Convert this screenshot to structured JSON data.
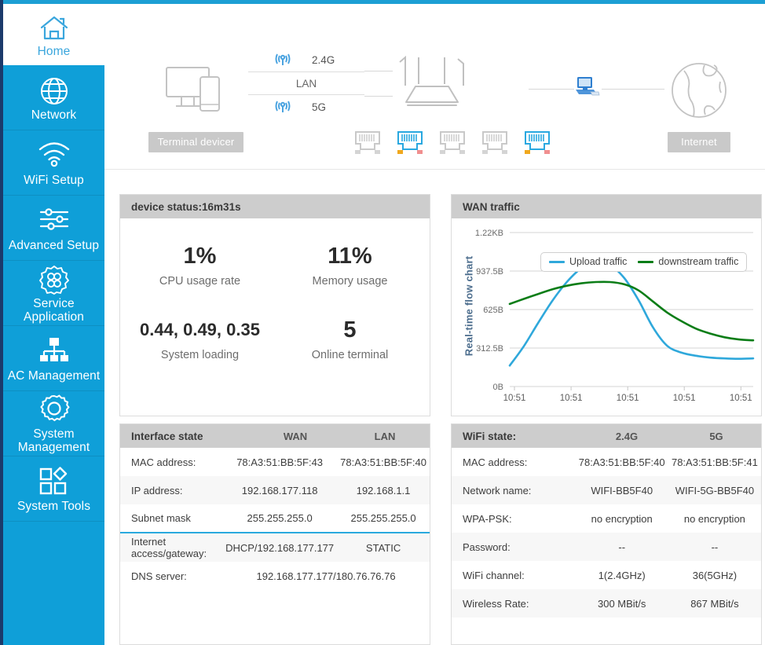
{
  "theme": {
    "sidebar_blue": "#0f9fd8",
    "top_bar_blue": "#1c9fd4",
    "left_edge_navy": "#1b3a6b",
    "panel_head_grey": "#cdcdcd",
    "badge_grey": "#c9c9c9",
    "accent_blue": "#2aa9de",
    "upload_color": "#2fa8db",
    "downstream_color": "#0b7d17"
  },
  "sidebar": {
    "items": [
      {
        "label": "Home",
        "icon": "home-icon",
        "active": true
      },
      {
        "label": "Network",
        "icon": "globe-icon",
        "active": false
      },
      {
        "label": "WiFi Setup",
        "icon": "wifi-icon",
        "active": false
      },
      {
        "label": "Advanced Setup",
        "icon": "sliders-icon",
        "active": false
      },
      {
        "label": "Service\nApplication",
        "icon": "service-icon",
        "active": false
      },
      {
        "label": "AC Management",
        "icon": "network-tree-icon",
        "active": false
      },
      {
        "label": "System\nManagement",
        "icon": "gear-icon",
        "active": false
      },
      {
        "label": "System Tools",
        "icon": "tools-icon",
        "active": false
      }
    ]
  },
  "topology": {
    "terminal_badge": "Terminal devicer",
    "internet_badge": "Internet",
    "lan_label": "LAN",
    "band_24": "2.4G",
    "band_5": "5G",
    "ports": [
      {
        "name": "lan-port-1",
        "active": false
      },
      {
        "name": "lan-port-2",
        "active": true
      },
      {
        "name": "lan-port-3",
        "active": false
      },
      {
        "name": "lan-port-4",
        "active": false
      },
      {
        "name": "lan-port-5",
        "active": true
      }
    ]
  },
  "device_status": {
    "title": "device status:16m31s",
    "stats": [
      {
        "value": "1%",
        "label": "CPU usage rate",
        "big": true
      },
      {
        "value": "11%",
        "label": "Memory usage",
        "big": true
      },
      {
        "value": "0.44, 0.49, 0.35",
        "label": "System loading",
        "big": false
      },
      {
        "value": "5",
        "label": "Online terminal",
        "big": true
      }
    ]
  },
  "wan_traffic": {
    "title": "WAN traffic"
  },
  "chart_data": {
    "type": "line",
    "title": "WAN traffic",
    "xlabel": "",
    "ylabel": "Real-time flow chart",
    "grid": true,
    "legend_position": "top-center",
    "ylim": [
      0,
      1250
    ],
    "yticks": [
      0,
      312.5,
      625,
      937.5,
      1250
    ],
    "ytick_labels": [
      "0B",
      "312.5B",
      "625B",
      "937.5B",
      "1.22KB"
    ],
    "x": [
      "10:51",
      "10:51",
      "10:51",
      "10:51",
      "10:51"
    ],
    "xtick_labels": [
      "10:51",
      "10:51",
      "10:51",
      "10:51",
      "10:51"
    ],
    "series": [
      {
        "name": "Upload traffic",
        "color": "#2fa8db",
        "values": [
          170,
          330,
          520,
          700,
          850,
          960,
          1000,
          985,
          880,
          700,
          480,
          330,
          275,
          250,
          235,
          228,
          225,
          228
        ]
      },
      {
        "name": "downstream traffic",
        "color": "#0b7d17",
        "values": [
          670,
          712,
          752,
          790,
          818,
          838,
          848,
          848,
          830,
          780,
          690,
          600,
          530,
          470,
          430,
          400,
          382,
          375
        ]
      }
    ],
    "legend": [
      "Upload traffic",
      "downstream traffic"
    ]
  },
  "interface_state": {
    "title": "Interface state",
    "columns": [
      "WAN",
      "LAN"
    ],
    "rows": [
      {
        "key": "MAC address:",
        "wan": "78:A3:51:BB:5F:43",
        "lan": "78:A3:51:BB:5F:40",
        "span": false,
        "sep": false
      },
      {
        "key": "IP address:",
        "wan": "192.168.177.118",
        "lan": "192.168.1.1",
        "span": false,
        "sep": false
      },
      {
        "key": "Subnet mask",
        "wan": "255.255.255.0",
        "lan": "255.255.255.0",
        "span": false,
        "sep": false
      },
      {
        "key": "Internet access/gateway:",
        "wan": "DHCP/192.168.177.177",
        "lan": "STATIC",
        "span": false,
        "sep": true
      },
      {
        "key": "DNS server:",
        "wan": "192.168.177.177/180.76.76.76",
        "lan": "",
        "span": true,
        "sep": false
      }
    ]
  },
  "wifi_state": {
    "title": "WiFi state:",
    "columns": [
      "2.4G",
      "5G"
    ],
    "rows": [
      {
        "key": "MAC address:",
        "g24": "78:A3:51:BB:5F:40",
        "g5": "78:A3:51:BB:5F:41"
      },
      {
        "key": "Network name:",
        "g24": "WIFI-BB5F40",
        "g5": "WIFI-5G-BB5F40"
      },
      {
        "key": "WPA-PSK:",
        "g24": "no encryption",
        "g5": "no encryption"
      },
      {
        "key": "Password:",
        "g24": "--",
        "g5": "--"
      },
      {
        "key": "WiFi channel:",
        "g24": "1(2.4GHz)",
        "g5": "36(5GHz)"
      },
      {
        "key": "Wireless Rate:",
        "g24": "300 MBit/s",
        "g5": "867 MBit/s"
      }
    ]
  }
}
